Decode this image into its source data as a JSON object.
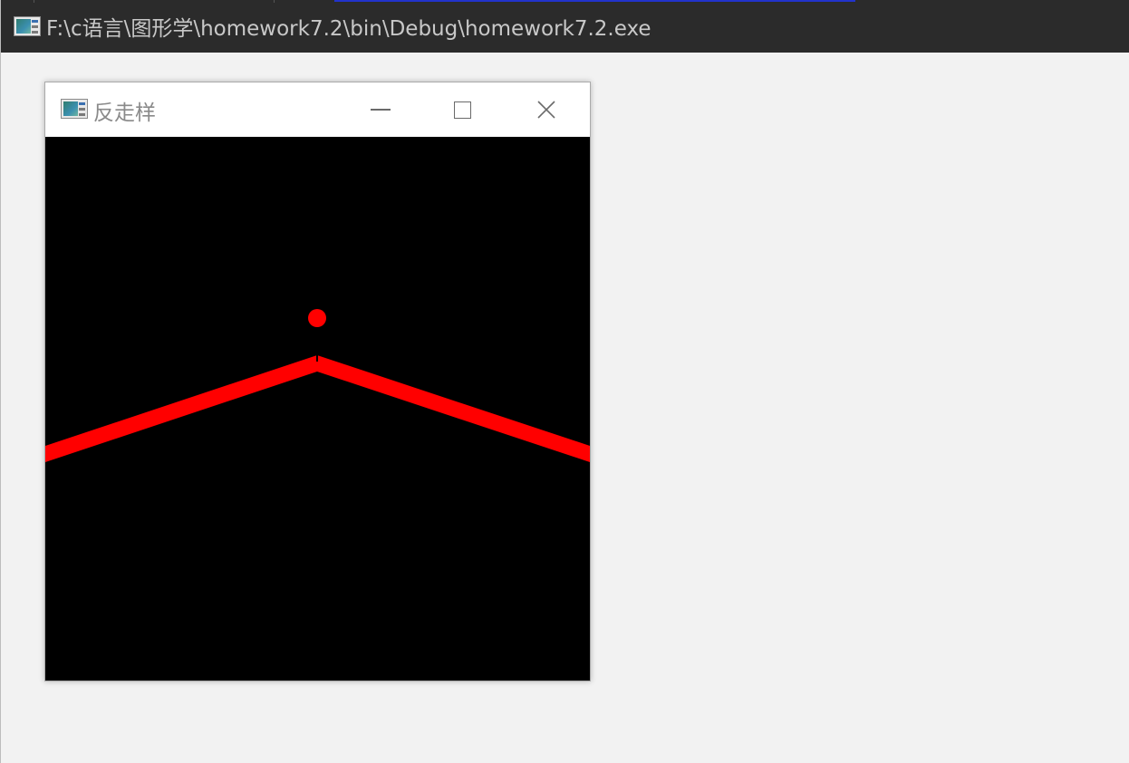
{
  "console": {
    "title": "F:\\c语言\\图形学\\homework7.2\\bin\\Debug\\homework7.2.exe",
    "icon": "app-window-icon"
  },
  "graphics_window": {
    "title": "反走样",
    "icon": "app-window-icon",
    "controls": {
      "minimize": "minimize-icon",
      "maximize": "maximize-icon",
      "close": "close-icon"
    },
    "canvas_background": "#000000",
    "drawing_color": "#ff0000"
  },
  "colors": {
    "console_titlebar": "#2b2b2b",
    "console_body": "#f2f2f2",
    "accent_strip": "#2233cc"
  }
}
